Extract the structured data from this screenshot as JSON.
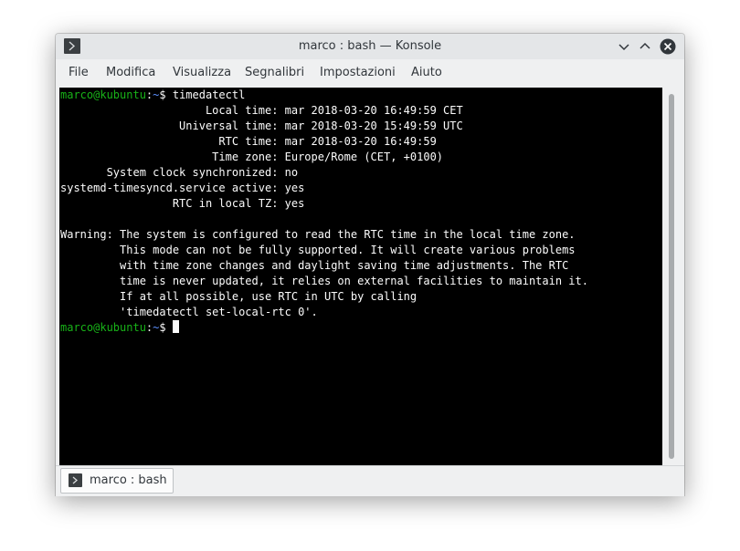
{
  "window": {
    "title": "marco : bash — Konsole",
    "icon": "konsole-icon",
    "controls": [
      "minimize-icon",
      "maximize-icon",
      "close-icon"
    ]
  },
  "menu": [
    "File",
    "Modifica",
    "Visualizza",
    "Segnalibri",
    "Impostazioni",
    "Aiuto"
  ],
  "terminal": {
    "prompt": {
      "user_host": "marco@kubuntu",
      "colon": ":",
      "path": "~",
      "symbol": "$"
    },
    "command": " timedatectl",
    "output": [
      "                      Local time: mar 2018-03-20 16:49:59 CET",
      "                  Universal time: mar 2018-03-20 15:49:59 UTC",
      "                        RTC time: mar 2018-03-20 16:49:59",
      "                       Time zone: Europe/Rome (CET, +0100)",
      "       System clock synchronized: no",
      "systemd-timesyncd.service active: yes",
      "                 RTC in local TZ: yes",
      "",
      "Warning: The system is configured to read the RTC time in the local time zone.",
      "         This mode can not be fully supported. It will create various problems",
      "         with time zone changes and daylight saving time adjustments. The RTC",
      "         time is never updated, it relies on external facilities to maintain it.",
      "         If at all possible, use RTC in UTC by calling",
      "         'timedatectl set-local-rtc 0'."
    ],
    "colors": {
      "background": "#000000",
      "text": "#fcfcfc",
      "user_host": "#18b218",
      "path": "#5d91ff"
    }
  },
  "tabs": [
    {
      "label": "marco : bash",
      "icon": "konsole-icon"
    }
  ]
}
